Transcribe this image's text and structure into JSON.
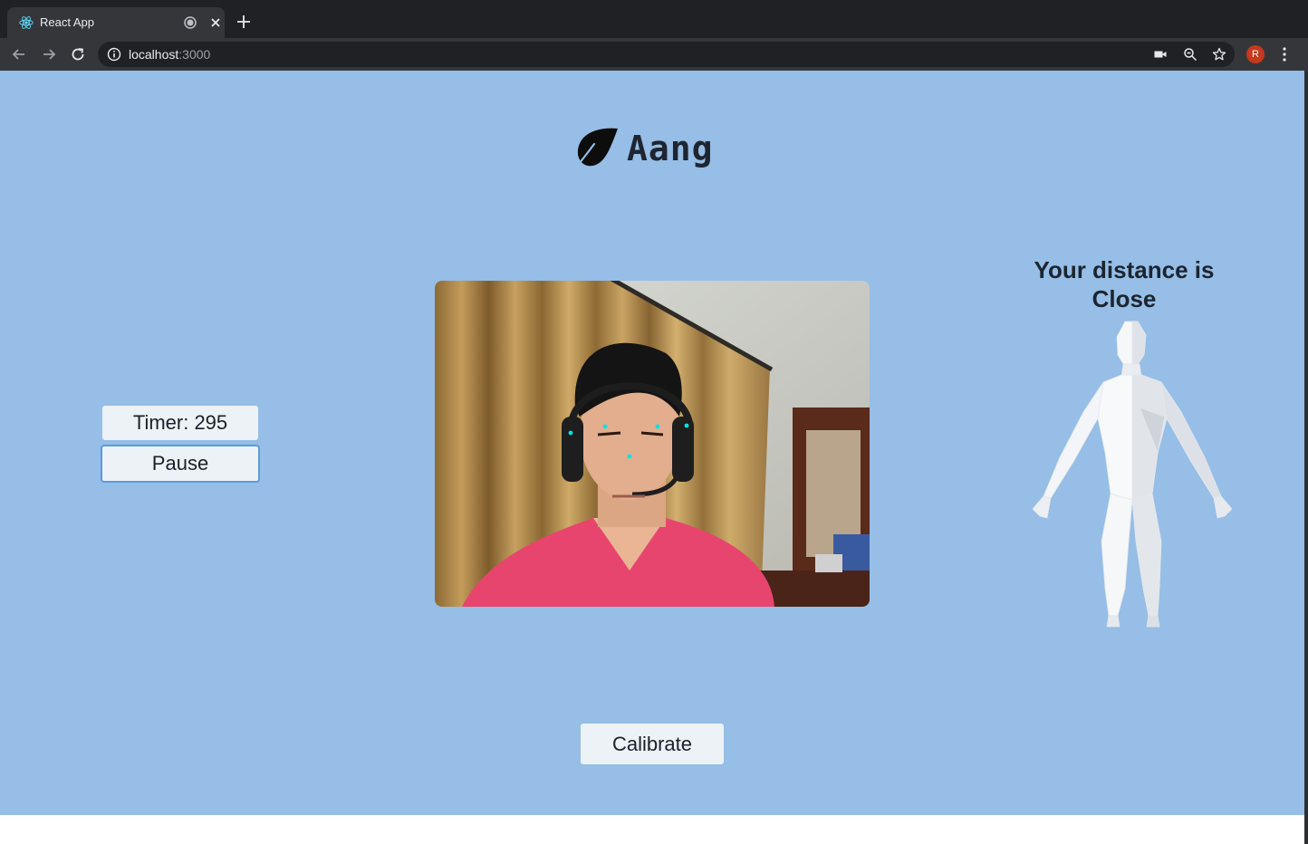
{
  "browser": {
    "tab_title": "React App",
    "url_host": "localhost",
    "url_port": ":3000",
    "profile_initial": "R"
  },
  "app": {
    "logo_text": "Aang",
    "timer_label": "Timer: 295",
    "pause_label": "Pause",
    "distance_line1": "Your distance is",
    "distance_line2": "Close",
    "calibrate_label": "Calibrate"
  },
  "colors": {
    "page_background": "#96bee6",
    "button_background": "#edf2f7",
    "landmark_dots": "#00e5e5"
  },
  "icons": [
    "react-favicon-icon",
    "recording-icon",
    "close-icon",
    "plus-icon",
    "back-arrow-icon",
    "forward-arrow-icon",
    "reload-icon",
    "info-icon",
    "camera-icon",
    "zoom-icon",
    "star-icon",
    "more-vert-icon",
    "leaf-icon"
  ]
}
